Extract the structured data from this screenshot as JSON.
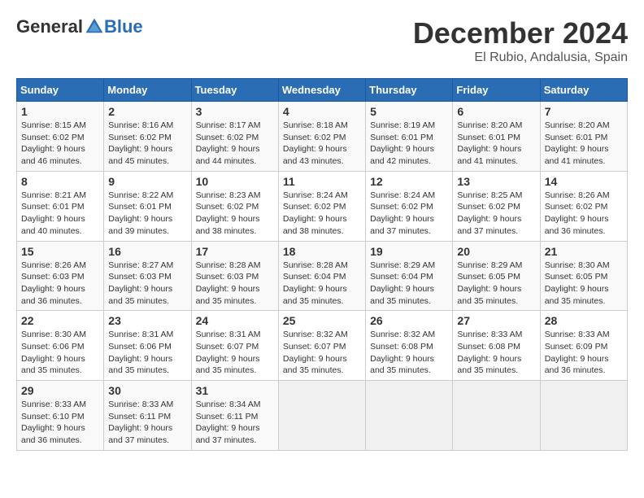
{
  "logo": {
    "general": "General",
    "blue": "Blue"
  },
  "header": {
    "month": "December 2024",
    "location": "El Rubio, Andalusia, Spain"
  },
  "weekdays": [
    "Sunday",
    "Monday",
    "Tuesday",
    "Wednesday",
    "Thursday",
    "Friday",
    "Saturday"
  ],
  "weeks": [
    [
      {
        "day": "1",
        "sunrise": "Sunrise: 8:15 AM",
        "sunset": "Sunset: 6:02 PM",
        "daylight": "Daylight: 9 hours and 46 minutes."
      },
      {
        "day": "2",
        "sunrise": "Sunrise: 8:16 AM",
        "sunset": "Sunset: 6:02 PM",
        "daylight": "Daylight: 9 hours and 45 minutes."
      },
      {
        "day": "3",
        "sunrise": "Sunrise: 8:17 AM",
        "sunset": "Sunset: 6:02 PM",
        "daylight": "Daylight: 9 hours and 44 minutes."
      },
      {
        "day": "4",
        "sunrise": "Sunrise: 8:18 AM",
        "sunset": "Sunset: 6:02 PM",
        "daylight": "Daylight: 9 hours and 43 minutes."
      },
      {
        "day": "5",
        "sunrise": "Sunrise: 8:19 AM",
        "sunset": "Sunset: 6:01 PM",
        "daylight": "Daylight: 9 hours and 42 minutes."
      },
      {
        "day": "6",
        "sunrise": "Sunrise: 8:20 AM",
        "sunset": "Sunset: 6:01 PM",
        "daylight": "Daylight: 9 hours and 41 minutes."
      },
      {
        "day": "7",
        "sunrise": "Sunrise: 8:20 AM",
        "sunset": "Sunset: 6:01 PM",
        "daylight": "Daylight: 9 hours and 41 minutes."
      }
    ],
    [
      {
        "day": "8",
        "sunrise": "Sunrise: 8:21 AM",
        "sunset": "Sunset: 6:01 PM",
        "daylight": "Daylight: 9 hours and 40 minutes."
      },
      {
        "day": "9",
        "sunrise": "Sunrise: 8:22 AM",
        "sunset": "Sunset: 6:01 PM",
        "daylight": "Daylight: 9 hours and 39 minutes."
      },
      {
        "day": "10",
        "sunrise": "Sunrise: 8:23 AM",
        "sunset": "Sunset: 6:02 PM",
        "daylight": "Daylight: 9 hours and 38 minutes."
      },
      {
        "day": "11",
        "sunrise": "Sunrise: 8:24 AM",
        "sunset": "Sunset: 6:02 PM",
        "daylight": "Daylight: 9 hours and 38 minutes."
      },
      {
        "day": "12",
        "sunrise": "Sunrise: 8:24 AM",
        "sunset": "Sunset: 6:02 PM",
        "daylight": "Daylight: 9 hours and 37 minutes."
      },
      {
        "day": "13",
        "sunrise": "Sunrise: 8:25 AM",
        "sunset": "Sunset: 6:02 PM",
        "daylight": "Daylight: 9 hours and 37 minutes."
      },
      {
        "day": "14",
        "sunrise": "Sunrise: 8:26 AM",
        "sunset": "Sunset: 6:02 PM",
        "daylight": "Daylight: 9 hours and 36 minutes."
      }
    ],
    [
      {
        "day": "15",
        "sunrise": "Sunrise: 8:26 AM",
        "sunset": "Sunset: 6:03 PM",
        "daylight": "Daylight: 9 hours and 36 minutes."
      },
      {
        "day": "16",
        "sunrise": "Sunrise: 8:27 AM",
        "sunset": "Sunset: 6:03 PM",
        "daylight": "Daylight: 9 hours and 35 minutes."
      },
      {
        "day": "17",
        "sunrise": "Sunrise: 8:28 AM",
        "sunset": "Sunset: 6:03 PM",
        "daylight": "Daylight: 9 hours and 35 minutes."
      },
      {
        "day": "18",
        "sunrise": "Sunrise: 8:28 AM",
        "sunset": "Sunset: 6:04 PM",
        "daylight": "Daylight: 9 hours and 35 minutes."
      },
      {
        "day": "19",
        "sunrise": "Sunrise: 8:29 AM",
        "sunset": "Sunset: 6:04 PM",
        "daylight": "Daylight: 9 hours and 35 minutes."
      },
      {
        "day": "20",
        "sunrise": "Sunrise: 8:29 AM",
        "sunset": "Sunset: 6:05 PM",
        "daylight": "Daylight: 9 hours and 35 minutes."
      },
      {
        "day": "21",
        "sunrise": "Sunrise: 8:30 AM",
        "sunset": "Sunset: 6:05 PM",
        "daylight": "Daylight: 9 hours and 35 minutes."
      }
    ],
    [
      {
        "day": "22",
        "sunrise": "Sunrise: 8:30 AM",
        "sunset": "Sunset: 6:06 PM",
        "daylight": "Daylight: 9 hours and 35 minutes."
      },
      {
        "day": "23",
        "sunrise": "Sunrise: 8:31 AM",
        "sunset": "Sunset: 6:06 PM",
        "daylight": "Daylight: 9 hours and 35 minutes."
      },
      {
        "day": "24",
        "sunrise": "Sunrise: 8:31 AM",
        "sunset": "Sunset: 6:07 PM",
        "daylight": "Daylight: 9 hours and 35 minutes."
      },
      {
        "day": "25",
        "sunrise": "Sunrise: 8:32 AM",
        "sunset": "Sunset: 6:07 PM",
        "daylight": "Daylight: 9 hours and 35 minutes."
      },
      {
        "day": "26",
        "sunrise": "Sunrise: 8:32 AM",
        "sunset": "Sunset: 6:08 PM",
        "daylight": "Daylight: 9 hours and 35 minutes."
      },
      {
        "day": "27",
        "sunrise": "Sunrise: 8:33 AM",
        "sunset": "Sunset: 6:08 PM",
        "daylight": "Daylight: 9 hours and 35 minutes."
      },
      {
        "day": "28",
        "sunrise": "Sunrise: 8:33 AM",
        "sunset": "Sunset: 6:09 PM",
        "daylight": "Daylight: 9 hours and 36 minutes."
      }
    ],
    [
      {
        "day": "29",
        "sunrise": "Sunrise: 8:33 AM",
        "sunset": "Sunset: 6:10 PM",
        "daylight": "Daylight: 9 hours and 36 minutes."
      },
      {
        "day": "30",
        "sunrise": "Sunrise: 8:33 AM",
        "sunset": "Sunset: 6:11 PM",
        "daylight": "Daylight: 9 hours and 37 minutes."
      },
      {
        "day": "31",
        "sunrise": "Sunrise: 8:34 AM",
        "sunset": "Sunset: 6:11 PM",
        "daylight": "Daylight: 9 hours and 37 minutes."
      },
      null,
      null,
      null,
      null
    ]
  ]
}
